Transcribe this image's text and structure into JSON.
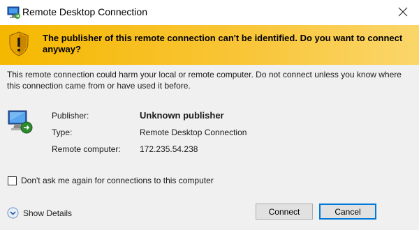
{
  "window": {
    "title": "Remote Desktop Connection",
    "icons": {
      "app": "remote-desktop-icon",
      "close": "close-icon"
    }
  },
  "warning": {
    "icon": "warning-shield-icon",
    "text": "The publisher of this remote connection can't be identified. Do you want to connect anyway?"
  },
  "description": "This remote connection could harm your local or remote computer. Do not connect unless you know where this connection came from or have used it before.",
  "details": {
    "icon": "computer-connection-icon",
    "rows": [
      {
        "label": "Publisher:",
        "value": "Unknown publisher"
      },
      {
        "label": "Type:",
        "value": "Remote Desktop Connection"
      },
      {
        "label": "Remote computer:",
        "value": "172.235.54.238"
      }
    ]
  },
  "checkbox": {
    "label": "Don't ask me again for connections to this computer",
    "checked": false
  },
  "footer": {
    "show_details": "Show Details",
    "show_details_icon": "chevron-down-circle-icon",
    "connect": "Connect",
    "cancel": "Cancel"
  },
  "colors": {
    "warning_bar": "#f7c01a",
    "accent": "#0078d7"
  }
}
